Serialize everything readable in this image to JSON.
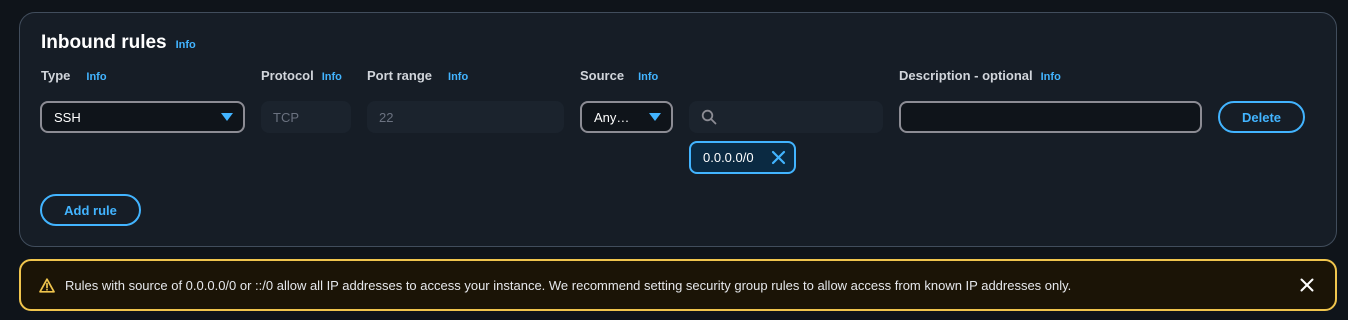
{
  "inbound_rules": {
    "title": "Inbound rules",
    "title_info": "Info",
    "columns": {
      "type": {
        "label": "Type",
        "info": "Info"
      },
      "protocol": {
        "label": "Protocol",
        "info": "Info"
      },
      "port_range": {
        "label": "Port range",
        "info": "Info"
      },
      "source": {
        "label": "Source",
        "info": "Info"
      },
      "description": {
        "label": "Description - optional",
        "info": "Info"
      }
    },
    "rule": {
      "type_value": "SSH",
      "protocol_value": "TCP",
      "port_range_value": "22",
      "source_value": "Any…",
      "source_search_value": "",
      "source_token": "0.0.0.0/0",
      "description_value": "",
      "delete_label": "Delete"
    },
    "add_rule_label": "Add rule"
  },
  "warning": {
    "text": "Rules with source of 0.0.0.0/0 or ::/0 allow all IP addresses to access your instance. We recommend setting security group rules to allow access from known IP addresses only."
  },
  "colors": {
    "accent": "#42b4ff",
    "warning_border": "#f0c54d",
    "panel_bg": "#161d26",
    "page_bg": "#0f141a"
  },
  "icons": {
    "select_caret": "caret-down-icon",
    "search": "search-icon",
    "token_remove": "close-icon",
    "warning": "warning-icon",
    "dismiss": "close-icon"
  }
}
